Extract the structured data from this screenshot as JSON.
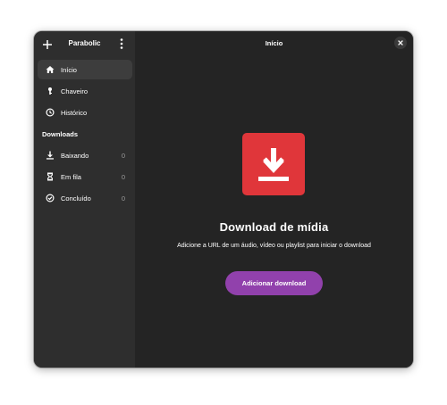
{
  "app": {
    "name": "Parabolic"
  },
  "header": {
    "page_title": "Início"
  },
  "sidebar": {
    "items": [
      {
        "label": "Início",
        "icon": "home-icon"
      },
      {
        "label": "Chaveiro",
        "icon": "keyring-icon"
      },
      {
        "label": "Histórico",
        "icon": "history-icon"
      }
    ],
    "downloads_section": {
      "title": "Downloads",
      "items": [
        {
          "label": "Baixando",
          "count": "0",
          "icon": "download-icon"
        },
        {
          "label": "Em fila",
          "count": "0",
          "icon": "hourglass-icon"
        },
        {
          "label": "Concluído",
          "count": "0",
          "icon": "check-circle-icon"
        }
      ]
    }
  },
  "status": {
    "title": "Download de mídia",
    "description": "Adicione a URL de um áudio, vídeo ou playlist para iniciar o download",
    "icon": "download-arrow-icon"
  },
  "actions": {
    "add_download": "Adicionar download"
  },
  "colors": {
    "sidebar_bg": "#2e2e2e",
    "main_bg": "#242424",
    "selected_bg": "#3d3d3d",
    "icon_red": "#e0363a",
    "accent_purple": "#9141ac"
  }
}
